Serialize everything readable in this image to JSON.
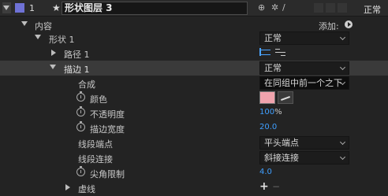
{
  "header": {
    "layer_number": "1",
    "layer_name": "形状图层 3",
    "blend_mode": "正常"
  },
  "tree": {
    "contents_label": "内容",
    "add_label": "添加:",
    "shape_label": "形状 1",
    "shape_blend": "正常",
    "path_label": "路径 1",
    "stroke_label": "描边 1",
    "stroke_blend": "正常",
    "composite_label": "合成",
    "composite_value": "在同组中前一个之下",
    "color_label": "颜色",
    "color_swatch": "#f0a3ad",
    "opacity_label": "不透明度",
    "opacity_value": "100",
    "opacity_unit": "%",
    "stroke_width_label": "描边宽度",
    "stroke_width_value": "20.0",
    "line_cap_label": "线段端点",
    "line_cap_value": "平头端点",
    "line_join_label": "线段连接",
    "line_join_value": "斜接连接",
    "miter_label": "尖角限制",
    "miter_value": "4.0",
    "dashes_label": "虚线",
    "dashes_add": "+",
    "dashes_remove": "−"
  }
}
